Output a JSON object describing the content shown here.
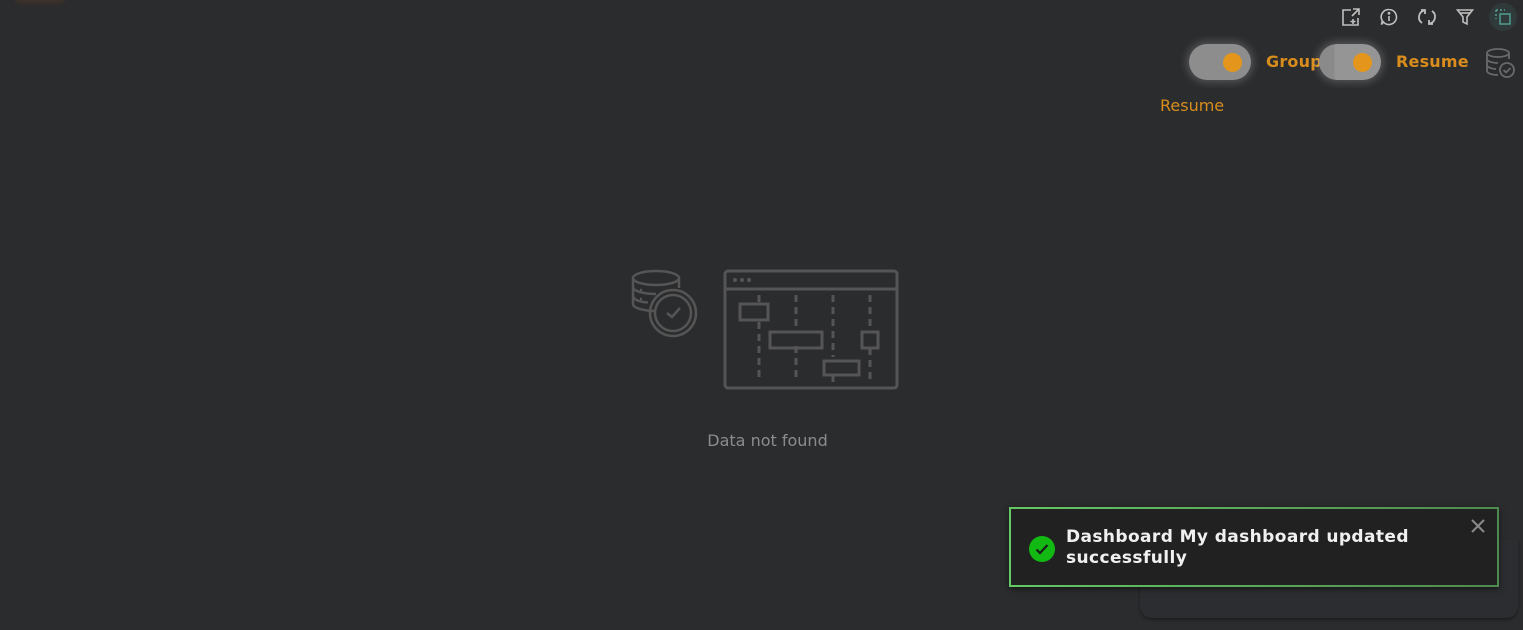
{
  "toolbar": {
    "buttons": [
      {
        "name": "export-icon",
        "label": "Export"
      },
      {
        "name": "info-icon",
        "label": "Info"
      },
      {
        "name": "refresh-icon",
        "label": "Refresh"
      },
      {
        "name": "filter-icon",
        "label": "Filter"
      },
      {
        "name": "select-area-icon",
        "label": "Select"
      }
    ]
  },
  "controls": {
    "group_toggle": {
      "label": "Group",
      "on": true
    },
    "resume_toggle": {
      "label": "Resume",
      "on": true
    },
    "resume_label": "Resume"
  },
  "empty_state": {
    "message": "Data not found"
  },
  "toast": {
    "message": "Dashboard My dashboard updated successfully",
    "status": "success"
  },
  "colors": {
    "background": "#2b2c2e",
    "accent": "#d88d1c",
    "toggle_knob": "#e3961b",
    "success": "#13b913",
    "toast_border": "#5cb85c",
    "icon_muted": "#555555"
  }
}
